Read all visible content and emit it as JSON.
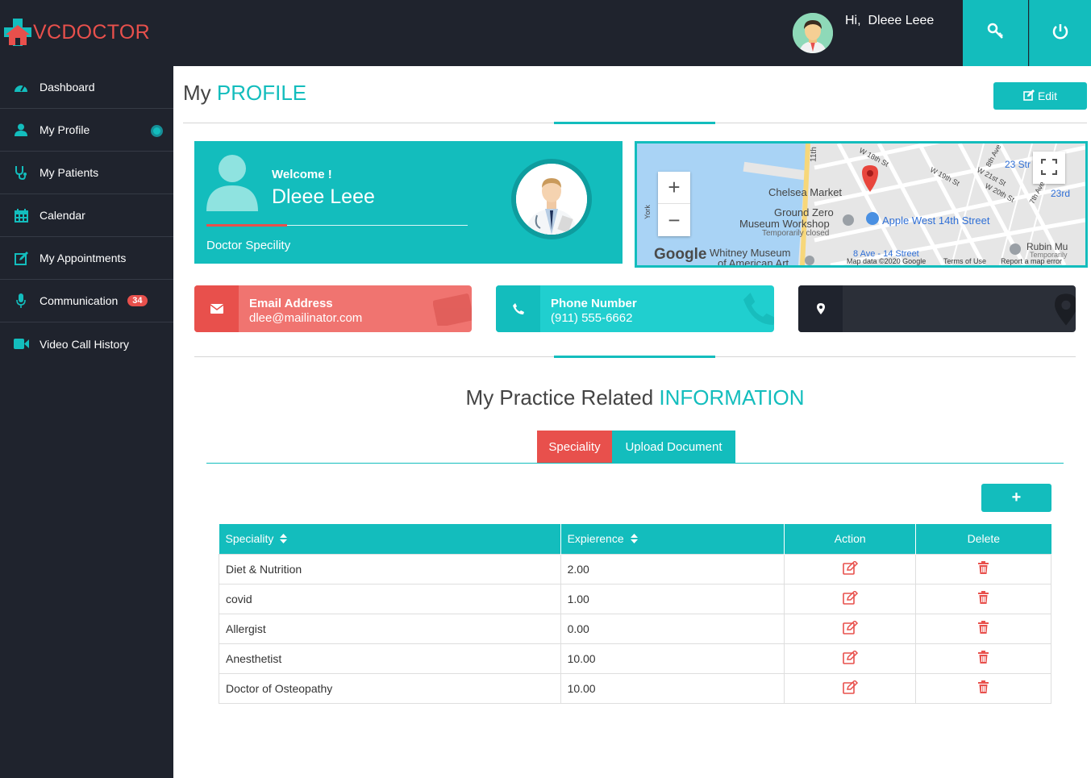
{
  "brand": {
    "name": "VCDOCTOR",
    "color": "#e8504c",
    "accent": "#13bdbd"
  },
  "header": {
    "greeting": "Hi,",
    "user_name": "Dleee Leee",
    "key_icon": "key-icon",
    "power_icon": "power-icon"
  },
  "sidebar": {
    "items": [
      {
        "label": "Dashboard",
        "icon": "dashboard-icon"
      },
      {
        "label": "My Profile",
        "icon": "user-icon",
        "active": true
      },
      {
        "label": "My Patients",
        "icon": "stethoscope-icon"
      },
      {
        "label": "Calendar",
        "icon": "calendar-icon"
      },
      {
        "label": "My Appointments",
        "icon": "edit-icon"
      },
      {
        "label": "Communication",
        "icon": "microphone-icon",
        "badge": "34"
      },
      {
        "label": "Video Call History",
        "icon": "video-icon"
      }
    ]
  },
  "page": {
    "title_plain": "My ",
    "title_accent": "PROFILE",
    "edit_label": "Edit"
  },
  "profile": {
    "welcome": "Welcome !",
    "name": "Dleee Leee",
    "specialty_label": "Doctor Specility"
  },
  "map": {
    "labels": {
      "chelsea": "Chelsea Market",
      "ground_zero_1": "Ground Zero",
      "ground_zero_2": "Museum Workshop",
      "temp_closed": "Temporarily closed",
      "apple": "Apple West 14th Street",
      "whitney_1": "Whitney Museum",
      "whitney_2": "of American Art",
      "w18": "W 18th St",
      "w19": "W 19th St",
      "w21": "W 21st St",
      "w20": "W 20th St",
      "ave8": "8th Ave",
      "ave7": "7th Ave",
      "str23": "23 Str",
      "rd23": "23rd",
      "rubin": "Rubin Mu",
      "temporarily": "Temporarily",
      "eleventh": "11th",
      "ave8b": "8 Ave - 14 Street",
      "york": "York"
    },
    "footer": {
      "google": "Google",
      "data": "Map data ©2020 Google",
      "terms": "Terms of Use",
      "report": "Report a map error"
    },
    "zoom_in": "+",
    "zoom_out": "−"
  },
  "contacts": {
    "email": {
      "label": "Email Address",
      "value": "dlee@mailinator.com",
      "icon": "envelope-icon"
    },
    "phone": {
      "label": "Phone Number",
      "value": "(911) 555-6662",
      "icon": "phone-icon"
    },
    "location": {
      "icon": "map-marker-icon"
    }
  },
  "practice": {
    "title_plain": "My Practice Related ",
    "title_accent": "INFORMATION",
    "tabs": [
      {
        "label": "Speciality",
        "active": true
      },
      {
        "label": "Upload Document"
      }
    ],
    "add_label": "+",
    "table": {
      "headers": {
        "speciality": "Speciality",
        "experience": "Expierence",
        "action": "Action",
        "delete": "Delete"
      },
      "rows": [
        {
          "speciality": "Diet & Nutrition",
          "experience": "2.00"
        },
        {
          "speciality": "covid",
          "experience": "1.00"
        },
        {
          "speciality": "Allergist",
          "experience": "0.00"
        },
        {
          "speciality": "Anesthetist",
          "experience": "10.00"
        },
        {
          "speciality": "Doctor of Osteopathy",
          "experience": "10.00"
        }
      ]
    }
  }
}
